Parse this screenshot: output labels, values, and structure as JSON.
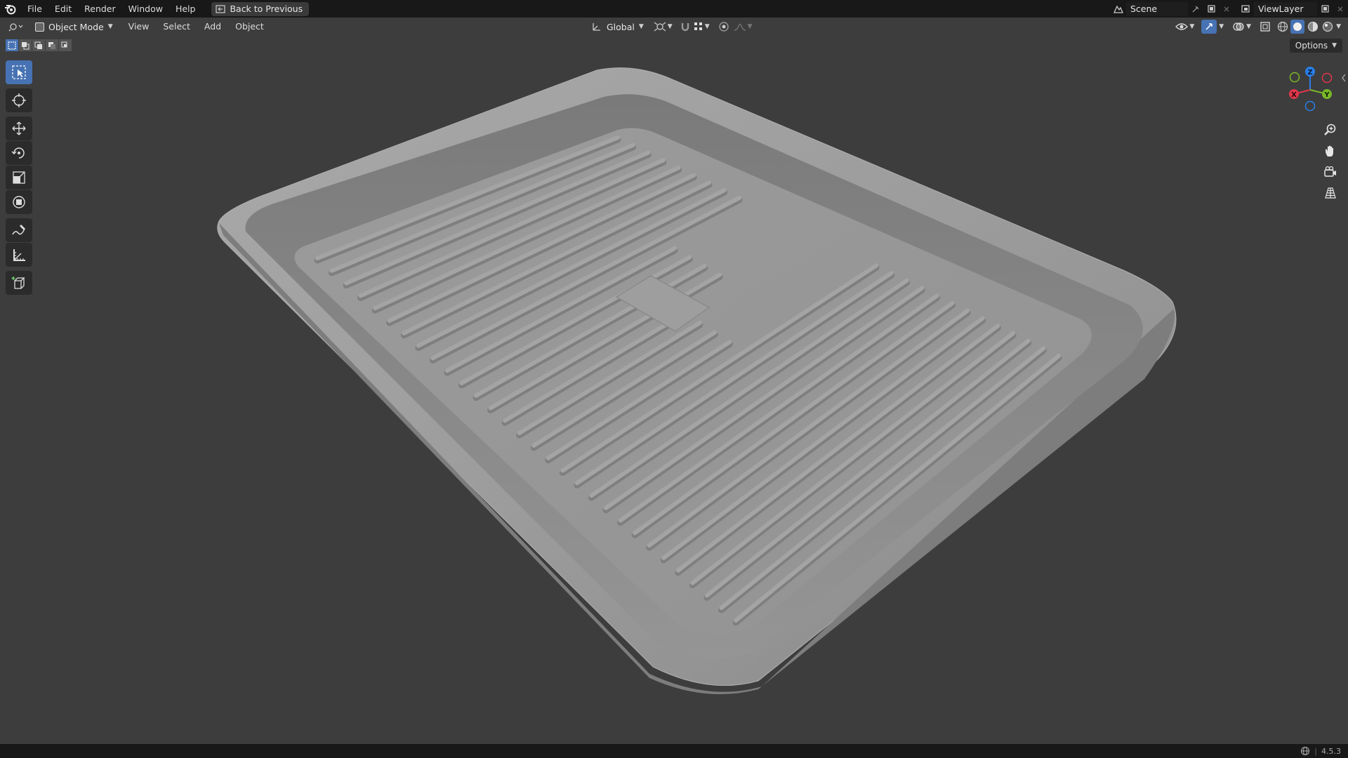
{
  "menu": {
    "file": "File",
    "edit": "Edit",
    "render": "Render",
    "window": "Window",
    "help": "Help",
    "back_to_previous": "Back to Previous"
  },
  "top_right": {
    "scene": "Scene",
    "view_layer": "ViewLayer"
  },
  "header": {
    "mode": "Object Mode",
    "view": "View",
    "select": "Select",
    "add": "Add",
    "object": "Object",
    "transform_orientation": "Global",
    "options": "Options"
  },
  "gizmo": {
    "x_label": "X",
    "y_label": "Y",
    "z_label": "Z",
    "x_color": "#e0364a",
    "y_color": "#7ab827",
    "z_color": "#2a7fe8"
  },
  "status": {
    "version": "4.5.3"
  },
  "colors": {
    "accent": "#4772b3",
    "viewport_bg": "#3d3d3d",
    "topbar_bg": "#181818",
    "model": "#9a9a9a"
  }
}
